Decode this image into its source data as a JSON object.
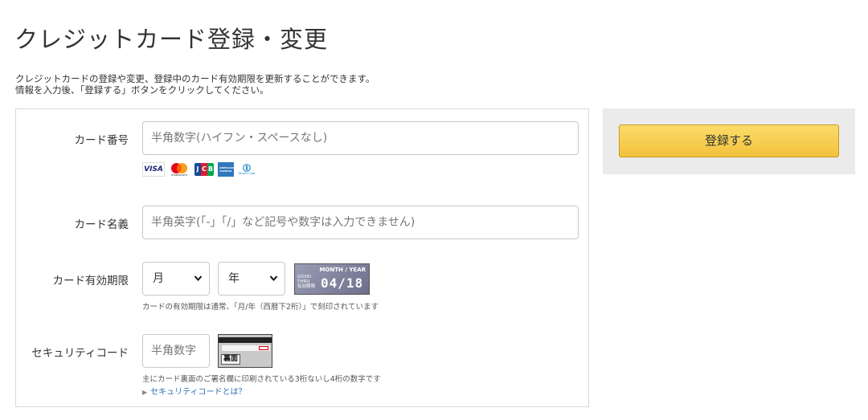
{
  "page": {
    "title": "クレジットカード登録・変更",
    "desc_line1": "クレジットカードの登録や変更、登録中のカード有効期限を更新することができます。",
    "desc_line2": "情報を入力後、「登録する」ボタンをクリックしてください。"
  },
  "form": {
    "card_number": {
      "label": "カード番号",
      "placeholder": "半角数字(ハイフン・スペースなし)",
      "value": ""
    },
    "card_brands": [
      "VISA",
      "Mastercard",
      "JCB",
      "American Express",
      "Diners Club"
    ],
    "brand_text": {
      "visa": "VISA",
      "mastercard": "mastercard",
      "jcb": "JCB",
      "amex": "AMERICAN EXPRESS",
      "diners": "Diners Club"
    },
    "card_name": {
      "label": "カード名義",
      "placeholder": "半角英字(「-」「/」など記号や数字は入力できません)",
      "value": ""
    },
    "expiry": {
      "label": "カード有効期限",
      "month_selected": "月",
      "year_selected": "年",
      "sample": {
        "header": "MONTH / YEAR",
        "good_thru_1": "GOOD",
        "good_thru_2": "THRU",
        "good_thru_3": "有効期限",
        "date": "04/18"
      },
      "hint": "カードの有効期限は通常、「月/年（西暦下2桁）」で刻印されています"
    },
    "security_code": {
      "label": "セキュリティコード",
      "placeholder": "半角数字",
      "value": "",
      "card_back_label": "裏面",
      "hint": "主にカード裏面のご署名欄に印刷されている3桁ないし4桁の数字です",
      "link": "セキュリティコードとは？"
    }
  },
  "side": {
    "submit_label": "登録する"
  },
  "colors": {
    "submit_top": "#fbdc6a",
    "submit_bottom": "#f3c13b",
    "link": "#2a6db5",
    "panel_bg": "#ebebeb"
  }
}
